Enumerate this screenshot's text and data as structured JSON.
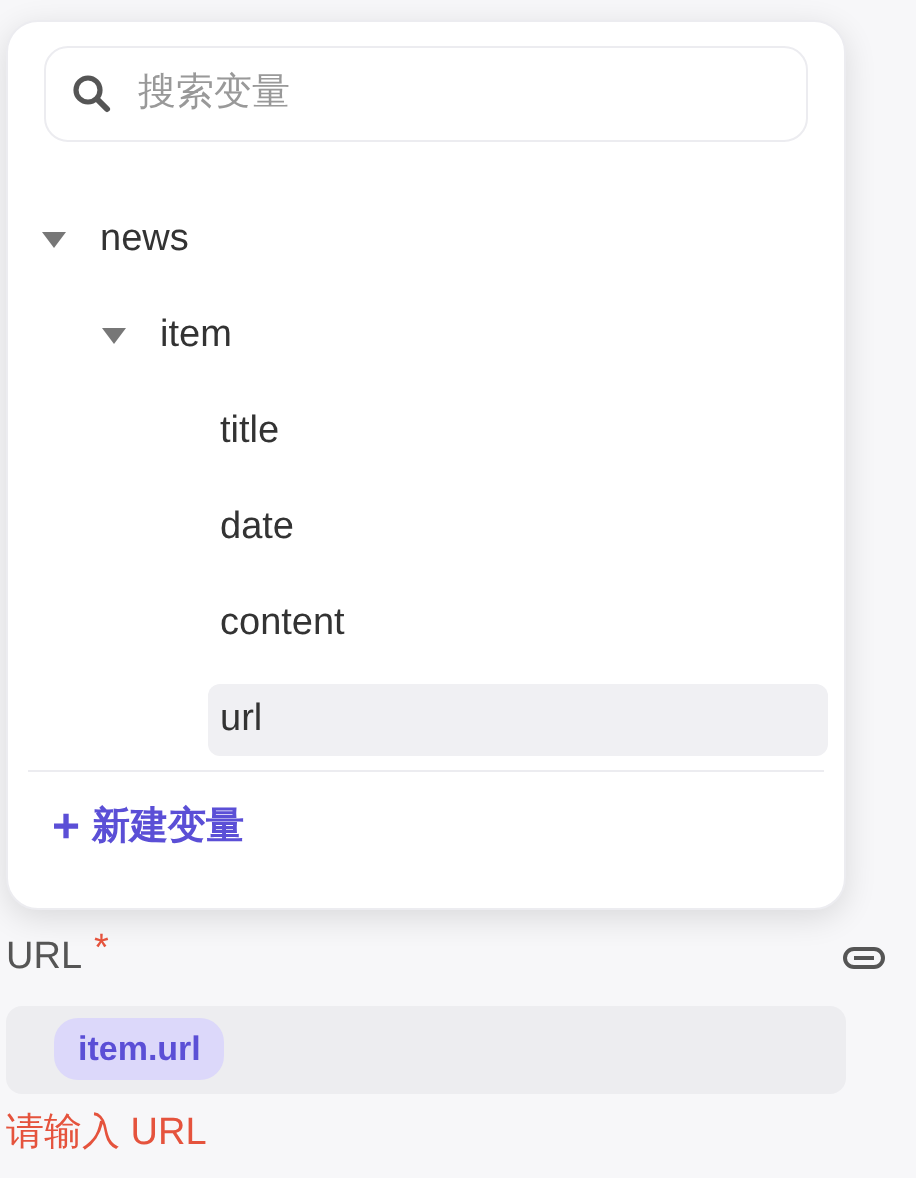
{
  "variable_picker": {
    "search": {
      "placeholder": "搜索变量"
    },
    "tree": [
      {
        "label": "news",
        "expanded": true,
        "selected": false,
        "children": [
          {
            "label": "item",
            "expanded": true,
            "selected": false,
            "children": [
              {
                "label": "title",
                "selected": false
              },
              {
                "label": "date",
                "selected": false
              },
              {
                "label": "content",
                "selected": false
              },
              {
                "label": "url",
                "selected": true
              }
            ]
          }
        ]
      }
    ],
    "new_variable_button": {
      "icon": "+",
      "label": "新建变量"
    }
  },
  "url_field": {
    "label": "URL",
    "required_mark": "*",
    "value_tag": "item.url",
    "error": "请输入 URL"
  }
}
